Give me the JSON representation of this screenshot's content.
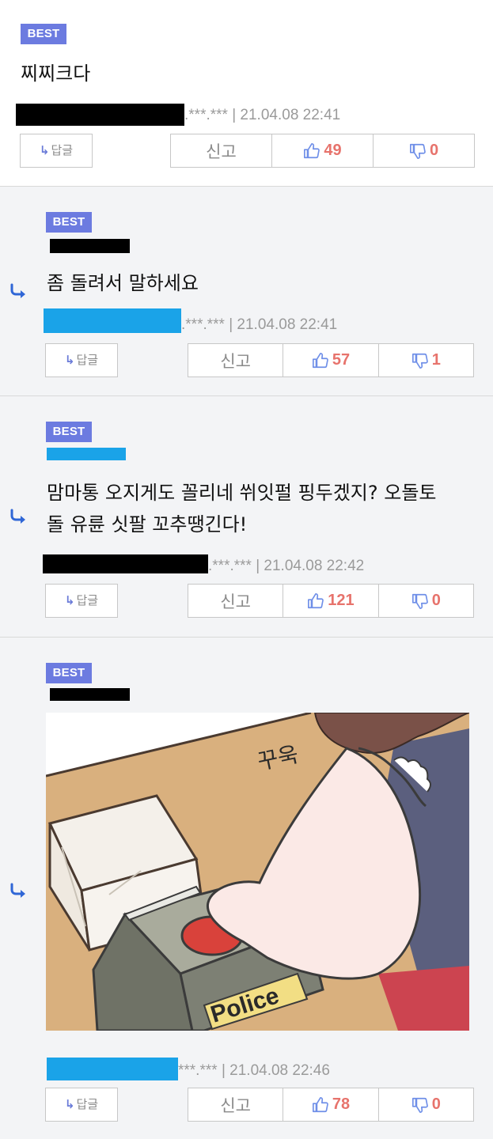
{
  "badge_label": "BEST",
  "reply_label": "답글",
  "report_label": "신고",
  "colors": {
    "badge": "#6c7be0",
    "vote_count": "#e7736c",
    "reply_arrow": "#2f66d6",
    "redact_blue": "#1aa3e8"
  },
  "comments": [
    {
      "text": "찌찌크다",
      "ip": ".***.***",
      "sep": "|",
      "time": "21.04.08 22:41",
      "likes": "49",
      "dislikes": "0"
    },
    {
      "text": "좀 돌려서 말하세요",
      "ip": ".***.***",
      "sep": "|",
      "time": "21.04.08 22:41",
      "likes": "57",
      "dislikes": "1"
    },
    {
      "text_line1": "맘마통 오지게도 꼴리네 쒸잇펄 핑두겠지? 오돌토",
      "text_line2": "돌 유륜 싯팔 꼬추땡긴다!",
      "ip": ".***.***",
      "sep": "|",
      "time": "21.04.08 22:42",
      "likes": "121",
      "dislikes": "0"
    },
    {
      "image_text": "Police",
      "image_sound": "꾸욱",
      "ip": "***.***",
      "sep": "|",
      "time": "21.04.08 22:46",
      "likes": "78",
      "dislikes": "0"
    }
  ]
}
